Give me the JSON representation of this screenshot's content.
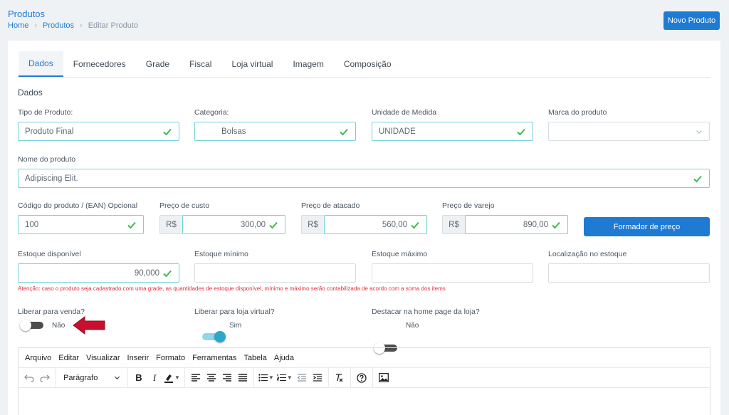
{
  "header": {
    "title": "Produtos",
    "breadcrumb": [
      "Home",
      "Produtos",
      "Editar Produto"
    ],
    "new_button": "Novo Produto"
  },
  "tabs": [
    "Dados",
    "Fornecedores",
    "Grade",
    "Fiscal",
    "Loja virtual",
    "Imagem",
    "Composição"
  ],
  "section_title": "Dados",
  "fields": {
    "tipo": {
      "label": "Tipo de Produto:",
      "value": "Produto Final"
    },
    "categoria": {
      "label": "Categoria:",
      "value": "Bolsas"
    },
    "unidade": {
      "label": "Unidade de Medida",
      "value": "UNIDADE"
    },
    "marca": {
      "label": "Marca do produto",
      "value": ""
    },
    "nome": {
      "label": "Nome do produto",
      "value": "Adipiscing Elit."
    },
    "codigo": {
      "label": "Código do produto / (EAN) Opcional",
      "value": "100"
    },
    "custo": {
      "label": "Preço de custo",
      "prefix": "R$",
      "value": "300,00"
    },
    "atacado": {
      "label": "Preço de atacado",
      "prefix": "R$",
      "value": "560,00"
    },
    "varejo": {
      "label": "Preço de varejo",
      "prefix": "R$",
      "value": "890,00"
    },
    "estoque": {
      "label": "Estoque disponível",
      "value": "90,000"
    },
    "minimo": {
      "label": "Estoque mínimo",
      "value": ""
    },
    "maximo": {
      "label": "Estoque máximo",
      "value": ""
    },
    "localizacao": {
      "label": "Localização no estoque",
      "value": ""
    }
  },
  "formador_button": "Formador de preço",
  "warning": "Atenção: caso o produto seja cadastrado com uma grade, as quantidades de estoque disponível, mínimo e máximo serão contabilizada de acordo com a soma dos items",
  "toggles": {
    "venda": {
      "label": "Liberar para venda?",
      "state": "Não"
    },
    "loja": {
      "label": "Liberar para loja virtual?",
      "state": "Sim"
    },
    "destaque": {
      "label": "Destacar na home page da loja?",
      "state": "Não"
    }
  },
  "editor": {
    "menu": [
      "Arquivo",
      "Editar",
      "Visualizar",
      "Inserir",
      "Formato",
      "Ferramentas",
      "Tabela",
      "Ajuda"
    ],
    "block_format": "Parágrafo",
    "bold": "B",
    "italic": "I"
  },
  "colors": {
    "primary": "#1f7ad4",
    "valid_border": "#74d3d8",
    "valid_check": "#3dbb4f",
    "warning": "#e0303c",
    "arrow": "#c8102e"
  }
}
